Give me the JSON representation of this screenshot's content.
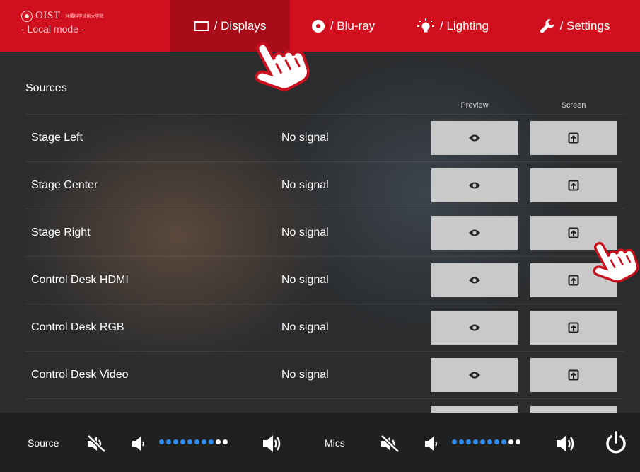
{
  "header": {
    "brand_name": "OIST",
    "brand_sub": "沖縄科学技術大学院",
    "mode": "- Local mode -",
    "tabs": [
      {
        "label": "/ Displays",
        "icon": "display-icon",
        "active": true
      },
      {
        "label": "/ Blu-ray",
        "icon": "disc-icon",
        "active": false
      },
      {
        "label": "/ Lighting",
        "icon": "lightbulb-icon",
        "active": false
      },
      {
        "label": "/ Settings",
        "icon": "wrench-icon",
        "active": false
      }
    ]
  },
  "sources": {
    "title": "Sources",
    "col_preview": "Preview",
    "col_screen": "Screen",
    "rows": [
      {
        "name": "Stage Left",
        "status": "No signal"
      },
      {
        "name": "Stage Center",
        "status": "No signal"
      },
      {
        "name": "Stage Right",
        "status": "No signal"
      },
      {
        "name": "Control Desk HDMI",
        "status": "No signal"
      },
      {
        "name": "Control Desk RGB",
        "status": "No signal"
      },
      {
        "name": "Control Desk Video",
        "status": "No signal"
      }
    ]
  },
  "footer": {
    "source_label": "Source",
    "mics_label": "Mics",
    "source_volume_fraction": 0.8,
    "mics_volume_fraction": 0.8,
    "dot_count": 10
  },
  "colors": {
    "header_red": "#d0101f",
    "active_tab": "#a70c18",
    "dot_on": "#2f8df0",
    "dot_off": "#ffffff",
    "button_gray": "#c9c9c9"
  }
}
